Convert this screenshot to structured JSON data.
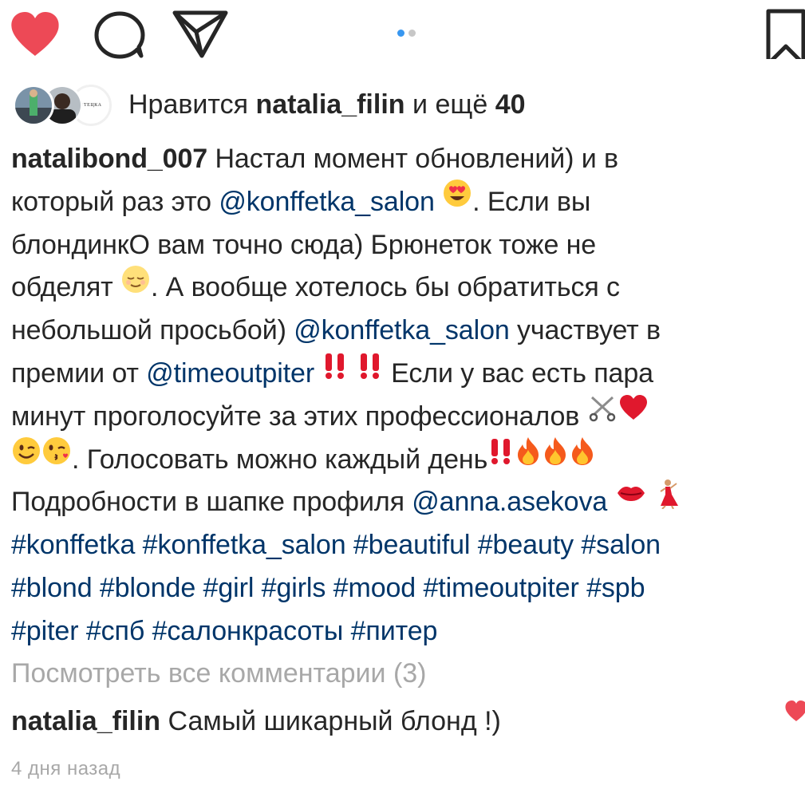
{
  "actions": {
    "like_icon": "heart-filled-icon",
    "comment_icon": "comment-bubble-icon",
    "share_icon": "paper-plane-icon",
    "save_icon": "bookmark-icon",
    "like_color": "#ed4956"
  },
  "carousel": {
    "active_index": 0,
    "count": 2,
    "active_color": "#3897f0",
    "inactive_color": "#c7c7c7"
  },
  "likes": {
    "prefix": "Нравится",
    "user": "natalia_filin",
    "middle": "и ещё",
    "count": "40",
    "avatar_badge": "ЯТЕЦКА"
  },
  "caption": {
    "username": "natalibond_007",
    "lines": [
      [
        {
          "t": "text",
          "v": " Настал момент обновлений) и в"
        }
      ],
      [
        {
          "t": "text",
          "v": "который раз это "
        },
        {
          "t": "mention",
          "v": "@konffetka_salon"
        },
        {
          "t": "text",
          "v": " "
        },
        {
          "t": "emoji",
          "v": "heart-eyes-emoji"
        },
        {
          "t": "text",
          "v": ". Если вы"
        }
      ],
      [
        {
          "t": "text",
          "v": "блондинкО вам точно сюда) Брюнеток тоже не"
        }
      ],
      [
        {
          "t": "text",
          "v": "обделят "
        },
        {
          "t": "emoji",
          "v": "relieved-face-emoji"
        },
        {
          "t": "text",
          "v": ". А вообще хотелось бы обратиться с"
        }
      ],
      [
        {
          "t": "text",
          "v": "небольшой просьбой) "
        },
        {
          "t": "mention",
          "v": "@konffetka_salon"
        },
        {
          "t": "text",
          "v": " участвует в"
        }
      ],
      [
        {
          "t": "text",
          "v": "премии от "
        },
        {
          "t": "mention",
          "v": "@timeoutpiter"
        },
        {
          "t": "text",
          "v": " "
        },
        {
          "t": "emoji",
          "v": "double-exclamation-emoji"
        },
        {
          "t": "text",
          "v": " "
        },
        {
          "t": "emoji",
          "v": "double-exclamation-emoji"
        },
        {
          "t": "text",
          "v": " Если у вас есть пара"
        }
      ],
      [
        {
          "t": "text",
          "v": "минут проголосуйте за этих профессионалов "
        },
        {
          "t": "emoji",
          "v": "scissors-emoji"
        },
        {
          "t": "emoji",
          "v": "red-heart-emoji"
        }
      ],
      [
        {
          "t": "emoji",
          "v": "winking-face-emoji"
        },
        {
          "t": "emoji",
          "v": "kissing-face-emoji"
        },
        {
          "t": "text",
          "v": ". Голосовать можно каждый день"
        },
        {
          "t": "emoji",
          "v": "double-exclamation-emoji"
        },
        {
          "t": "emoji",
          "v": "fire-emoji"
        },
        {
          "t": "emoji",
          "v": "fire-emoji"
        },
        {
          "t": "emoji",
          "v": "fire-emoji"
        }
      ],
      [
        {
          "t": "text",
          "v": "Подробности в шапке профиля "
        },
        {
          "t": "mention",
          "v": "@anna.asekova"
        },
        {
          "t": "text",
          "v": " "
        },
        {
          "t": "emoji",
          "v": "kiss-mark-emoji"
        },
        {
          "t": "text",
          "v": " "
        },
        {
          "t": "emoji",
          "v": "dancer-emoji"
        }
      ],
      [
        {
          "t": "tag",
          "v": "#konffetka"
        },
        {
          "t": "text",
          "v": " "
        },
        {
          "t": "tag",
          "v": "#konffetka_salon"
        },
        {
          "t": "text",
          "v": " "
        },
        {
          "t": "tag",
          "v": "#beautiful"
        },
        {
          "t": "text",
          "v": " "
        },
        {
          "t": "tag",
          "v": "#beauty"
        },
        {
          "t": "text",
          "v": " "
        },
        {
          "t": "tag",
          "v": "#salon"
        }
      ],
      [
        {
          "t": "tag",
          "v": "#blond"
        },
        {
          "t": "text",
          "v": " "
        },
        {
          "t": "tag",
          "v": "#blonde"
        },
        {
          "t": "text",
          "v": " "
        },
        {
          "t": "tag",
          "v": "#girl"
        },
        {
          "t": "text",
          "v": " "
        },
        {
          "t": "tag",
          "v": "#girls"
        },
        {
          "t": "text",
          "v": " "
        },
        {
          "t": "tag",
          "v": "#mood"
        },
        {
          "t": "text",
          "v": " "
        },
        {
          "t": "tag",
          "v": "#timeoutpiter"
        },
        {
          "t": "text",
          "v": " "
        },
        {
          "t": "tag",
          "v": "#spb"
        }
      ],
      [
        {
          "t": "tag",
          "v": "#piter"
        },
        {
          "t": "text",
          "v": " "
        },
        {
          "t": "tag",
          "v": "#спб"
        },
        {
          "t": "text",
          "v": " "
        },
        {
          "t": "tag",
          "v": "#салонкрасоты"
        },
        {
          "t": "text",
          "v": " "
        },
        {
          "t": "tag",
          "v": "#питер"
        }
      ]
    ]
  },
  "comments": {
    "view_all": "Посмотреть все комментарии (3)",
    "first": {
      "username": "natalia_filin",
      "text": " Самый шикарный блонд !)",
      "like_icon": "small-heart-icon"
    },
    "timestamp": "4 дня назад"
  }
}
